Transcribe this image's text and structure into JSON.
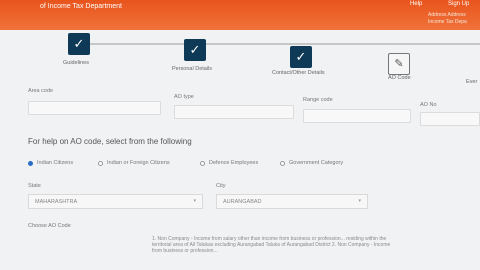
{
  "header": {
    "brand": "of Income Tax Department",
    "links": [
      "Help",
      "Sign Up"
    ],
    "right_text_1": "Address Address",
    "right_text_2": "Income Tax Depa"
  },
  "stepper": {
    "steps": [
      {
        "label": "Guidelines",
        "icon": "check"
      },
      {
        "label": "Personal Details",
        "icon": "check"
      },
      {
        "label": "Contact/Other Details",
        "icon": "check"
      },
      {
        "label": "AO Code",
        "icon": "edit"
      },
      {
        "label": "Ever",
        "icon": ""
      }
    ],
    "check_glyph": "✓",
    "edit_glyph": "✎"
  },
  "ao_fields": {
    "area_code": "Area code",
    "ao_type": "AO type",
    "range_code": "Range code",
    "ao_no": "AO No"
  },
  "help_title": "For help on AO code, select from the following",
  "citizen_options": [
    {
      "label": "Indian Citizens",
      "selected": true
    },
    {
      "label": "Indian or Foreign Citizens",
      "selected": false
    },
    {
      "label": "Defence Employees",
      "selected": false
    },
    {
      "label": "Government Category",
      "selected": false
    }
  ],
  "location": {
    "state_label": "State",
    "state_value": "MAHARASHTRA",
    "city_label": "City",
    "city_value": "AURANGABAD"
  },
  "choose_ao": "Choose AO Code",
  "ao_description": "1. Non Company - Income from salary other than income from business or profession... residing within the territorial area of All Talukas excluding Aurangabad Taluka of Aurangabad District 2. Non Company - Income from business or profession..."
}
